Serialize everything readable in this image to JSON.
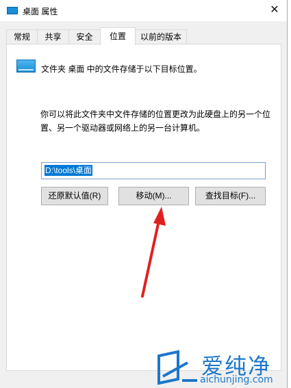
{
  "window": {
    "title": "桌面 属性",
    "close_glyph": "✕"
  },
  "tabs": [
    {
      "label": "常规",
      "active": false
    },
    {
      "label": "共享",
      "active": false
    },
    {
      "label": "安全",
      "active": false
    },
    {
      "label": "位置",
      "active": true
    },
    {
      "label": "以前的版本",
      "active": false
    }
  ],
  "location": {
    "header": "文件夹 桌面 中的文件存储于以下目标位置。",
    "description": "你可以将此文件夹中文件存储的位置更改为此硬盘上的另一个位置、另一个驱动器或网络上的另一台计算机。",
    "path_value": "D:\\tools\\桌面",
    "buttons": {
      "restore": "还原默认值(R)",
      "move": "移动(M)...",
      "find_target": "查找目标(F)..."
    }
  },
  "watermark": {
    "chars": "爱纯净",
    "url": "aichunjing.com"
  },
  "colors": {
    "accent": "#1a8fd8",
    "selection": "#0078d7",
    "annotation_arrow": "#e02020",
    "watermark": "#1c77cc"
  }
}
